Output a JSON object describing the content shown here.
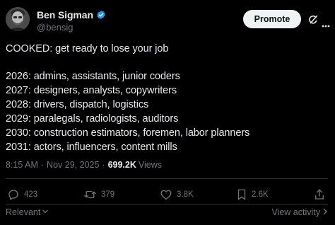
{
  "author": {
    "display_name": "Ben Sigman",
    "handle": "@bensig",
    "verified": true
  },
  "header": {
    "promote_label": "Promote"
  },
  "tweet": {
    "lines": [
      "COOKED: get ready to lose your job",
      "",
      "2026: admins, assistants, junior coders",
      "2027: designers, analysts, copywriters",
      "2028: drivers, dispatch, logistics",
      "2029: paralegals, radiologists, auditors",
      "2030: construction estimators, foremen, labor planners",
      "2031: actors, influencers, content mills"
    ]
  },
  "meta": {
    "time": "8:15 AM",
    "separator": "·",
    "date": "Nov 29, 2025",
    "views_count": "699.2K",
    "views_label": "Views"
  },
  "actions": {
    "replies": "423",
    "reposts": "379",
    "likes": "3.8K",
    "bookmarks": "2.6K"
  },
  "footer": {
    "sort_label": "Relevant",
    "activity_label": "View activity"
  },
  "icons": {
    "verified": "verified-badge-icon",
    "grok": "grok-icon",
    "more": "more-icon",
    "reply": "reply-icon",
    "repost": "repost-icon",
    "like": "heart-icon",
    "bookmark": "bookmark-icon",
    "share": "share-icon"
  },
  "colors": {
    "background": "#000000",
    "text_primary": "#e7e9ea",
    "text_secondary": "#71767b",
    "verified_blue": "#1d9bf0",
    "divider": "#2f3336",
    "promote_bg": "#eff3f4"
  }
}
